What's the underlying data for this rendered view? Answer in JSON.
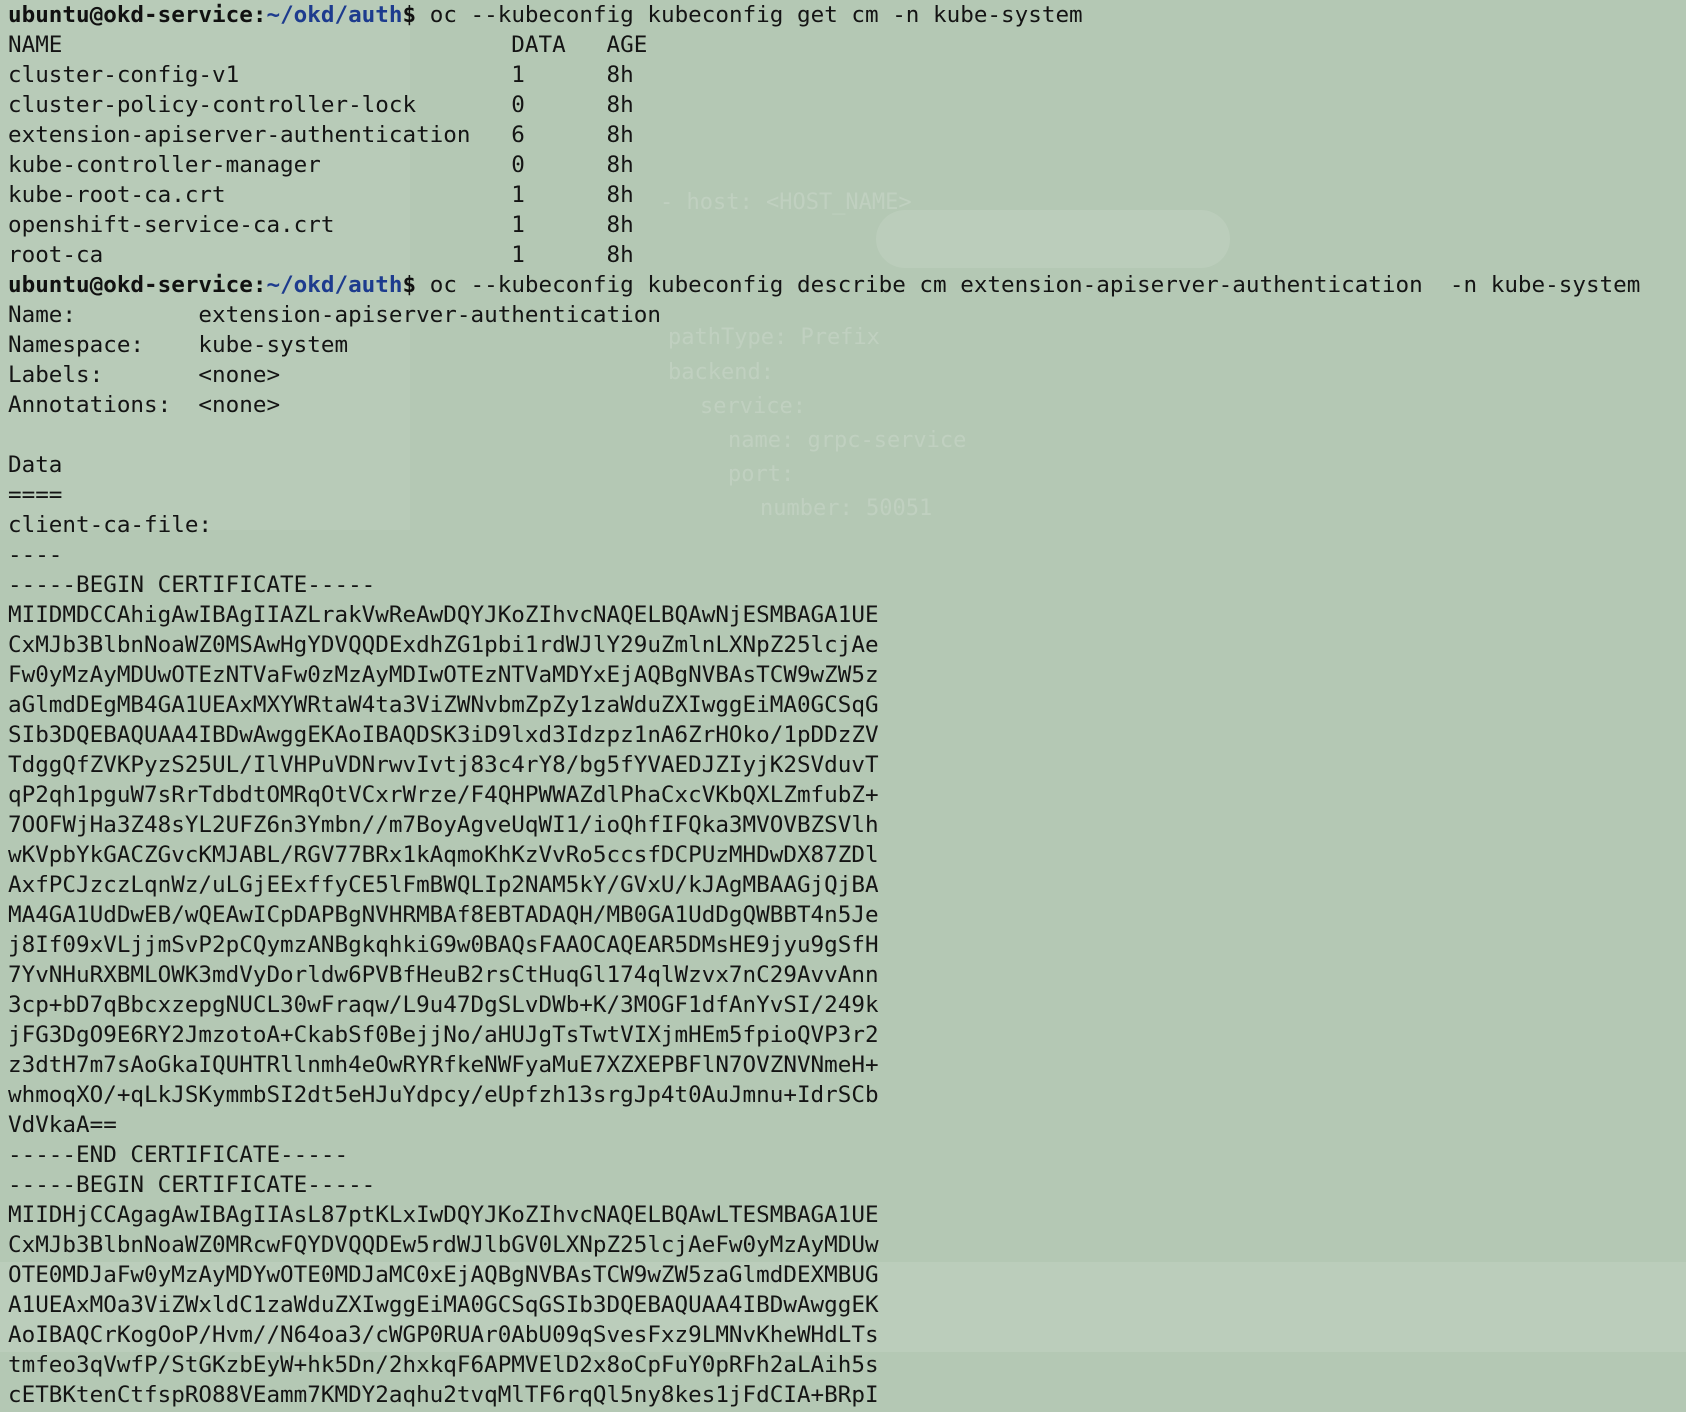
{
  "terminal": {
    "user_host": "ubuntu@okd-service",
    "path": "~/okd/auth",
    "commands": [
      "oc --kubeconfig kubeconfig get cm -n kube-system",
      "oc --kubeconfig kubeconfig describe cm extension-apiserver-authentication  -n kube-system"
    ],
    "cm_table_header": "NAME                                 DATA   AGE",
    "cm_table_rows": [
      "cluster-config-v1                    1      8h",
      "cluster-policy-controller-lock       0      8h",
      "extension-apiserver-authentication   6      8h",
      "kube-controller-manager              0      8h",
      "kube-root-ca.crt                     1      8h",
      "openshift-service-ca.crt             1      8h",
      "root-ca                              1      8h"
    ],
    "describe_lines": [
      "Name:         extension-apiserver-authentication",
      "Namespace:    kube-system",
      "Labels:       <none>",
      "Annotations:  <none>",
      "",
      "Data",
      "====",
      "client-ca-file:",
      "----",
      "-----BEGIN CERTIFICATE-----",
      "MIIDMDCCAhigAwIBAgIIAZLrakVwReAwDQYJKoZIhvcNAQELBQAwNjESMBAGA1UE",
      "CxMJb3BlbnNoaWZ0MSAwHgYDVQQDExdhZG1pbi1rdWJlY29uZmlnLXNpZ25lcjAe",
      "Fw0yMzAyMDUwOTEzNTVaFw0zMzAyMDIwOTEzNTVaMDYxEjAQBgNVBAsTCW9wZW5z",
      "aGlmdDEgMB4GA1UEAxMXYWRtaW4ta3ViZWNvbmZpZy1zaWduZXIwggEiMA0GCSqG",
      "SIb3DQEBAQUAA4IBDwAwggEKAoIBAQDSK3iD9lxd3Idzpz1nA6ZrHOko/1pDDzZV",
      "TdggQfZVKPyzS25UL/IlVHPuVDNrwvIvtj83c4rY8/bg5fYVAEDJZIyjK2SVduvT",
      "qP2qh1pguW7sRrTdbdtOMRqOtVCxrWrze/F4QHPWWAZdlPhaCxcVKbQXLZmfubZ+",
      "7OOFWjHa3Z48sYL2UFZ6n3Ymbn//m7BoyAgveUqWI1/ioQhfIFQka3MVOVBZSVlh",
      "wKVpbYkGACZGvcKMJABL/RGV77BRx1kAqmoKhKzVvRo5ccsfDCPUzMHDwDX87ZDl",
      "AxfPCJzczLqnWz/uLGjEExffyCE5lFmBWQLIp2NAM5kY/GVxU/kJAgMBAAGjQjBA",
      "MA4GA1UdDwEB/wQEAwICpDAPBgNVHRMBAf8EBTADAQH/MB0GA1UdDgQWBBT4n5Je",
      "j8If09xVLjjmSvP2pCQymzANBgkqhkiG9w0BAQsFAAOCAQEAR5DMsHE9jyu9gSfH",
      "7YvNHuRXBMLOWK3mdVyDorldw6PVBfHeuB2rsCtHuqGl174qlWzvx7nC29AvvAnn",
      "3cp+bD7qBbcxzepgNUCL30wFraqw/L9u47DgSLvDWb+K/3MOGF1dfAnYvSI/249k",
      "jFG3DgO9E6RY2JmzotoA+CkabSf0BejjNo/aHUJgTsTwtVIXjmHEm5fpioQVP3r2",
      "z3dtH7m7sAoGkaIQUHTRllnmh4eOwRYRfkeNWFyaMuE7XZXEPBFlN7OVZNVNmeH+",
      "whmoqXO/+qLkJSKymmbSI2dt5eHJuYdpcy/eUpfzh13srgJp4t0AuJmnu+IdrSCb",
      "VdVkaA==",
      "-----END CERTIFICATE-----",
      "-----BEGIN CERTIFICATE-----",
      "MIIDHjCCAgagAwIBAgIIAsL87ptKLxIwDQYJKoZIhvcNAQELBQAwLTESMBAGA1UE",
      "CxMJb3BlbnNoaWZ0MRcwFQYDVQQDEw5rdWJlbGV0LXNpZ25lcjAeFw0yMzAyMDUw",
      "OTE0MDJaFw0yMzAyMDYwOTE0MDJaMC0xEjAQBgNVBAsTCW9wZW5zaGlmdDEXMBUG",
      "A1UEAxMOa3ViZWxldC1zaWduZXIwggEiMA0GCSqGSIb3DQEBAQUAA4IBDwAwggEK",
      "AoIBAQCrKogOoP/Hvm//N64oa3/cWGP0RUAr0AbU09qSvesFxz9LMNvKheWHdLTs",
      "tmfeo3qVwfP/StGKzbEyW+hk5Dn/2hxkqF6APMVElD2x8oCpFuY0pRFh2aLAih5s",
      "cETBKtenCtfspRO88VEamm7KMDY2aqhu2tvqMlTF6rqQl5ny8kes1jFdCIA+BRpI"
    ]
  }
}
